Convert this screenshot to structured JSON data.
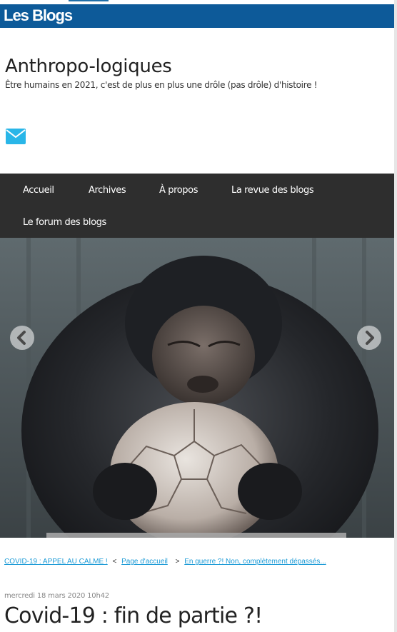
{
  "portal": {
    "logo_text": "Les Blogs"
  },
  "blog": {
    "title": "Anthropo-logiques",
    "subtitle": "Être humains en 2021, c'est de plus en plus une drôle (pas drôle) d'histoire !",
    "contact_icon": "mail-icon"
  },
  "nav": {
    "items": [
      {
        "label": "Accueil"
      },
      {
        "label": "Archives"
      },
      {
        "label": "À propos"
      },
      {
        "label": "La revue des blogs"
      },
      {
        "label": "Le forum des blogs"
      }
    ]
  },
  "slider": {
    "image": "chimpanzee-with-worn-football-photo",
    "prev_icon": "chevron-left-icon",
    "next_icon": "chevron-right-icon"
  },
  "breadcrumb": {
    "prev_post": "COVID-19 : APPEL AU CALME !",
    "home": "Page d'accueil",
    "next_post": "En guerre ?! Non, complètement dépassés...",
    "sep_left": "<",
    "sep_right": ">"
  },
  "post": {
    "date": "mercredi 18 mars 2020 10h42",
    "title": "Covid-19 : fin de partie ?!"
  },
  "colors": {
    "brand_blue": "#0d5a99",
    "nav_bg": "#2e2e2e",
    "link": "#1a9ad6",
    "mail_icon": "#29b6e8"
  }
}
